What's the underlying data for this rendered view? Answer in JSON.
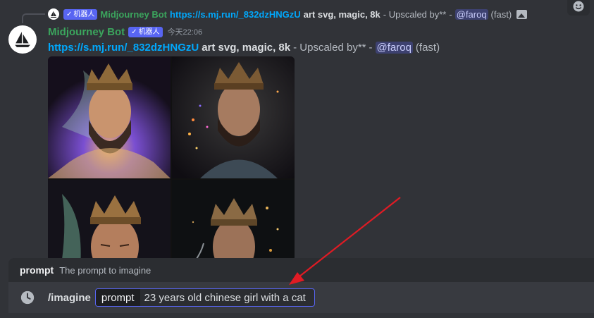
{
  "reply": {
    "bot_tag": "机器人",
    "author": "Midjourney Bot",
    "link": "https://s.mj.run/_832dzHNGzU",
    "prompt_text": "art svg, magic, 8k",
    "suffix": "- Upscaled by**",
    "separator": "-",
    "mention": "@faroq",
    "speed": "(fast)",
    "attachment_icon": "image-icon"
  },
  "message": {
    "author": "Midjourney Bot",
    "bot_tag": "机器人",
    "timestamp": "今天22:06",
    "link": "https://s.mj.run/_832dzHNGzU",
    "prompt_text": "art svg, magic, 8k",
    "suffix": "- Upscaled by**",
    "separator": "-",
    "mention": "@faroq",
    "speed": "(fast)",
    "avatar_icon": "sailboat-icon"
  },
  "image_grid": {
    "tiles": [
      "king-portrait-smoke",
      "king-portrait-sparks",
      "king-portrait-eyes-closed",
      "king-portrait-gold-dust"
    ]
  },
  "command_popup": {
    "option_name": "prompt",
    "option_description": "The prompt to imagine"
  },
  "input": {
    "command": "/imagine",
    "option_label": "prompt",
    "option_value": "23 years old chinese girl with a cat"
  },
  "colors": {
    "background": "#313338",
    "bot_green": "#3ba55d",
    "link_blue": "#00a8fc",
    "brand": "#5865f2",
    "arrow_red": "#e01b24"
  }
}
